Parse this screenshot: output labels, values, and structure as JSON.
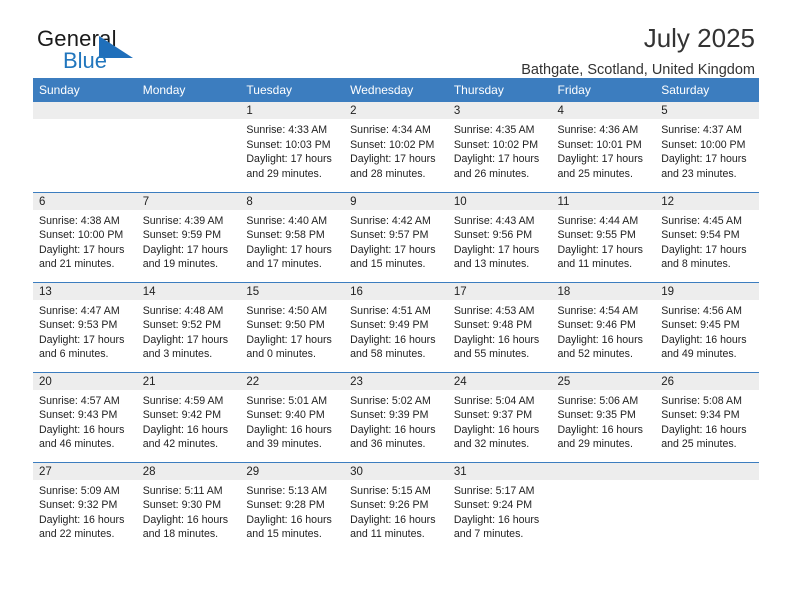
{
  "brand": {
    "name_top": "General",
    "name_bottom": "Blue",
    "accent_color": "#2176bd"
  },
  "header": {
    "title": "July 2025",
    "subtitle": "Bathgate, Scotland, United Kingdom"
  },
  "theme": {
    "header_bg": "#3c7dbf",
    "daynum_band_bg": "#ededed",
    "text_color": "#222222"
  },
  "weekday_headers": [
    "Sunday",
    "Monday",
    "Tuesday",
    "Wednesday",
    "Thursday",
    "Friday",
    "Saturday"
  ],
  "weeks": [
    [
      {
        "day": "",
        "sunrise": "",
        "sunset": "",
        "daylight_line1": "",
        "daylight_line2": ""
      },
      {
        "day": "",
        "sunrise": "",
        "sunset": "",
        "daylight_line1": "",
        "daylight_line2": ""
      },
      {
        "day": "1",
        "sunrise": "Sunrise: 4:33 AM",
        "sunset": "Sunset: 10:03 PM",
        "daylight_line1": "Daylight: 17 hours",
        "daylight_line2": "and 29 minutes."
      },
      {
        "day": "2",
        "sunrise": "Sunrise: 4:34 AM",
        "sunset": "Sunset: 10:02 PM",
        "daylight_line1": "Daylight: 17 hours",
        "daylight_line2": "and 28 minutes."
      },
      {
        "day": "3",
        "sunrise": "Sunrise: 4:35 AM",
        "sunset": "Sunset: 10:02 PM",
        "daylight_line1": "Daylight: 17 hours",
        "daylight_line2": "and 26 minutes."
      },
      {
        "day": "4",
        "sunrise": "Sunrise: 4:36 AM",
        "sunset": "Sunset: 10:01 PM",
        "daylight_line1": "Daylight: 17 hours",
        "daylight_line2": "and 25 minutes."
      },
      {
        "day": "5",
        "sunrise": "Sunrise: 4:37 AM",
        "sunset": "Sunset: 10:00 PM",
        "daylight_line1": "Daylight: 17 hours",
        "daylight_line2": "and 23 minutes."
      }
    ],
    [
      {
        "day": "6",
        "sunrise": "Sunrise: 4:38 AM",
        "sunset": "Sunset: 10:00 PM",
        "daylight_line1": "Daylight: 17 hours",
        "daylight_line2": "and 21 minutes."
      },
      {
        "day": "7",
        "sunrise": "Sunrise: 4:39 AM",
        "sunset": "Sunset: 9:59 PM",
        "daylight_line1": "Daylight: 17 hours",
        "daylight_line2": "and 19 minutes."
      },
      {
        "day": "8",
        "sunrise": "Sunrise: 4:40 AM",
        "sunset": "Sunset: 9:58 PM",
        "daylight_line1": "Daylight: 17 hours",
        "daylight_line2": "and 17 minutes."
      },
      {
        "day": "9",
        "sunrise": "Sunrise: 4:42 AM",
        "sunset": "Sunset: 9:57 PM",
        "daylight_line1": "Daylight: 17 hours",
        "daylight_line2": "and 15 minutes."
      },
      {
        "day": "10",
        "sunrise": "Sunrise: 4:43 AM",
        "sunset": "Sunset: 9:56 PM",
        "daylight_line1": "Daylight: 17 hours",
        "daylight_line2": "and 13 minutes."
      },
      {
        "day": "11",
        "sunrise": "Sunrise: 4:44 AM",
        "sunset": "Sunset: 9:55 PM",
        "daylight_line1": "Daylight: 17 hours",
        "daylight_line2": "and 11 minutes."
      },
      {
        "day": "12",
        "sunrise": "Sunrise: 4:45 AM",
        "sunset": "Sunset: 9:54 PM",
        "daylight_line1": "Daylight: 17 hours",
        "daylight_line2": "and 8 minutes."
      }
    ],
    [
      {
        "day": "13",
        "sunrise": "Sunrise: 4:47 AM",
        "sunset": "Sunset: 9:53 PM",
        "daylight_line1": "Daylight: 17 hours",
        "daylight_line2": "and 6 minutes."
      },
      {
        "day": "14",
        "sunrise": "Sunrise: 4:48 AM",
        "sunset": "Sunset: 9:52 PM",
        "daylight_line1": "Daylight: 17 hours",
        "daylight_line2": "and 3 minutes."
      },
      {
        "day": "15",
        "sunrise": "Sunrise: 4:50 AM",
        "sunset": "Sunset: 9:50 PM",
        "daylight_line1": "Daylight: 17 hours",
        "daylight_line2": "and 0 minutes."
      },
      {
        "day": "16",
        "sunrise": "Sunrise: 4:51 AM",
        "sunset": "Sunset: 9:49 PM",
        "daylight_line1": "Daylight: 16 hours",
        "daylight_line2": "and 58 minutes."
      },
      {
        "day": "17",
        "sunrise": "Sunrise: 4:53 AM",
        "sunset": "Sunset: 9:48 PM",
        "daylight_line1": "Daylight: 16 hours",
        "daylight_line2": "and 55 minutes."
      },
      {
        "day": "18",
        "sunrise": "Sunrise: 4:54 AM",
        "sunset": "Sunset: 9:46 PM",
        "daylight_line1": "Daylight: 16 hours",
        "daylight_line2": "and 52 minutes."
      },
      {
        "day": "19",
        "sunrise": "Sunrise: 4:56 AM",
        "sunset": "Sunset: 9:45 PM",
        "daylight_line1": "Daylight: 16 hours",
        "daylight_line2": "and 49 minutes."
      }
    ],
    [
      {
        "day": "20",
        "sunrise": "Sunrise: 4:57 AM",
        "sunset": "Sunset: 9:43 PM",
        "daylight_line1": "Daylight: 16 hours",
        "daylight_line2": "and 46 minutes."
      },
      {
        "day": "21",
        "sunrise": "Sunrise: 4:59 AM",
        "sunset": "Sunset: 9:42 PM",
        "daylight_line1": "Daylight: 16 hours",
        "daylight_line2": "and 42 minutes."
      },
      {
        "day": "22",
        "sunrise": "Sunrise: 5:01 AM",
        "sunset": "Sunset: 9:40 PM",
        "daylight_line1": "Daylight: 16 hours",
        "daylight_line2": "and 39 minutes."
      },
      {
        "day": "23",
        "sunrise": "Sunrise: 5:02 AM",
        "sunset": "Sunset: 9:39 PM",
        "daylight_line1": "Daylight: 16 hours",
        "daylight_line2": "and 36 minutes."
      },
      {
        "day": "24",
        "sunrise": "Sunrise: 5:04 AM",
        "sunset": "Sunset: 9:37 PM",
        "daylight_line1": "Daylight: 16 hours",
        "daylight_line2": "and 32 minutes."
      },
      {
        "day": "25",
        "sunrise": "Sunrise: 5:06 AM",
        "sunset": "Sunset: 9:35 PM",
        "daylight_line1": "Daylight: 16 hours",
        "daylight_line2": "and 29 minutes."
      },
      {
        "day": "26",
        "sunrise": "Sunrise: 5:08 AM",
        "sunset": "Sunset: 9:34 PM",
        "daylight_line1": "Daylight: 16 hours",
        "daylight_line2": "and 25 minutes."
      }
    ],
    [
      {
        "day": "27",
        "sunrise": "Sunrise: 5:09 AM",
        "sunset": "Sunset: 9:32 PM",
        "daylight_line1": "Daylight: 16 hours",
        "daylight_line2": "and 22 minutes."
      },
      {
        "day": "28",
        "sunrise": "Sunrise: 5:11 AM",
        "sunset": "Sunset: 9:30 PM",
        "daylight_line1": "Daylight: 16 hours",
        "daylight_line2": "and 18 minutes."
      },
      {
        "day": "29",
        "sunrise": "Sunrise: 5:13 AM",
        "sunset": "Sunset: 9:28 PM",
        "daylight_line1": "Daylight: 16 hours",
        "daylight_line2": "and 15 minutes."
      },
      {
        "day": "30",
        "sunrise": "Sunrise: 5:15 AM",
        "sunset": "Sunset: 9:26 PM",
        "daylight_line1": "Daylight: 16 hours",
        "daylight_line2": "and 11 minutes."
      },
      {
        "day": "31",
        "sunrise": "Sunrise: 5:17 AM",
        "sunset": "Sunset: 9:24 PM",
        "daylight_line1": "Daylight: 16 hours",
        "daylight_line2": "and 7 minutes."
      },
      {
        "day": "",
        "sunrise": "",
        "sunset": "",
        "daylight_line1": "",
        "daylight_line2": ""
      },
      {
        "day": "",
        "sunrise": "",
        "sunset": "",
        "daylight_line1": "",
        "daylight_line2": ""
      }
    ]
  ]
}
